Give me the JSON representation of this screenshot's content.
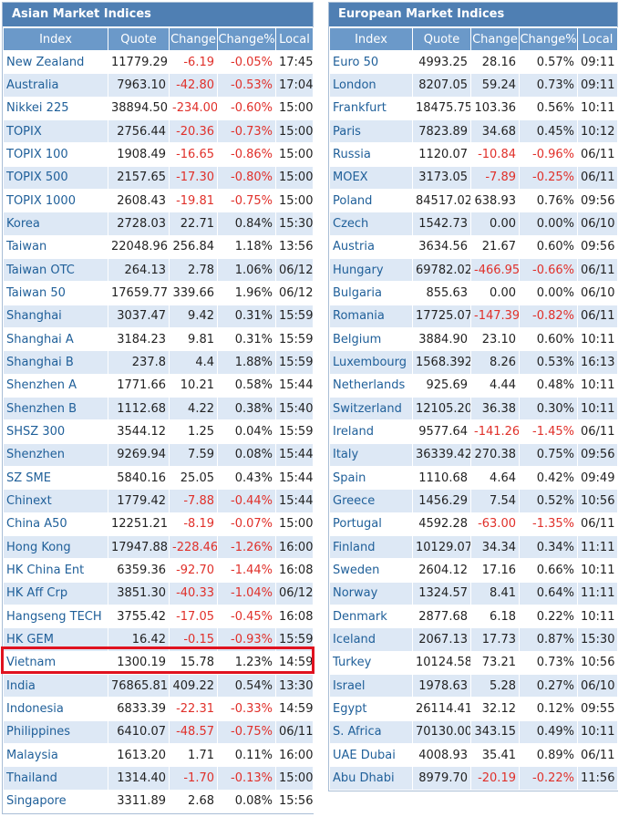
{
  "asia": {
    "title": "Asian Market Indices",
    "columns": [
      "Index",
      "Quote",
      "Change",
      "Change%",
      "Local"
    ],
    "rows": [
      {
        "name": "New Zealand",
        "quote": "11779.29",
        "change": "-6.19",
        "pct": "-0.05%",
        "time": "17:45"
      },
      {
        "name": "Australia",
        "quote": "7963.10",
        "change": "-42.80",
        "pct": "-0.53%",
        "time": "17:04"
      },
      {
        "name": "Nikkei 225",
        "quote": "38894.50",
        "change": "-234.00",
        "pct": "-0.60%",
        "time": "15:00"
      },
      {
        "name": "TOPIX",
        "quote": "2756.44",
        "change": "-20.36",
        "pct": "-0.73%",
        "time": "15:00"
      },
      {
        "name": "TOPIX 100",
        "quote": "1908.49",
        "change": "-16.65",
        "pct": "-0.86%",
        "time": "15:00"
      },
      {
        "name": "TOPIX 500",
        "quote": "2157.65",
        "change": "-17.30",
        "pct": "-0.80%",
        "time": "15:00"
      },
      {
        "name": "TOPIX 1000",
        "quote": "2608.43",
        "change": "-19.81",
        "pct": "-0.75%",
        "time": "15:00"
      },
      {
        "name": "Korea",
        "quote": "2728.03",
        "change": "22.71",
        "pct": "0.84%",
        "time": "15:30"
      },
      {
        "name": "Taiwan",
        "quote": "22048.96",
        "change": "256.84",
        "pct": "1.18%",
        "time": "13:56"
      },
      {
        "name": "Taiwan OTC",
        "quote": "264.13",
        "change": "2.78",
        "pct": "1.06%",
        "time": "06/12"
      },
      {
        "name": "Taiwan 50",
        "quote": "17659.77",
        "change": "339.66",
        "pct": "1.96%",
        "time": "06/12"
      },
      {
        "name": "Shanghai",
        "quote": "3037.47",
        "change": "9.42",
        "pct": "0.31%",
        "time": "15:59"
      },
      {
        "name": "Shanghai A",
        "quote": "3184.23",
        "change": "9.81",
        "pct": "0.31%",
        "time": "15:59"
      },
      {
        "name": "Shanghai B",
        "quote": "237.8",
        "change": "4.4",
        "pct": "1.88%",
        "time": "15:59"
      },
      {
        "name": "Shenzhen A",
        "quote": "1771.66",
        "change": "10.21",
        "pct": "0.58%",
        "time": "15:44"
      },
      {
        "name": "Shenzhen B",
        "quote": "1112.68",
        "change": "4.22",
        "pct": "0.38%",
        "time": "15:40"
      },
      {
        "name": "SHSZ 300",
        "quote": "3544.12",
        "change": "1.25",
        "pct": "0.04%",
        "time": "15:59"
      },
      {
        "name": "Shenzhen",
        "quote": "9269.94",
        "change": "7.59",
        "pct": "0.08%",
        "time": "15:44"
      },
      {
        "name": "SZ SME",
        "quote": "5840.16",
        "change": "25.05",
        "pct": "0.43%",
        "time": "15:44"
      },
      {
        "name": "Chinext",
        "quote": "1779.42",
        "change": "-7.88",
        "pct": "-0.44%",
        "time": "15:44"
      },
      {
        "name": "China A50",
        "quote": "12251.21",
        "change": "-8.19",
        "pct": "-0.07%",
        "time": "15:00"
      },
      {
        "name": "Hong Kong",
        "quote": "17947.88",
        "change": "-228.46",
        "pct": "-1.26%",
        "time": "16:00"
      },
      {
        "name": "HK China Ent",
        "quote": "6359.36",
        "change": "-92.70",
        "pct": "-1.44%",
        "time": "16:08"
      },
      {
        "name": "HK Aff Crp",
        "quote": "3851.30",
        "change": "-40.33",
        "pct": "-1.04%",
        "time": "06/12"
      },
      {
        "name": "Hangseng TECH",
        "quote": "3755.42",
        "change": "-17.05",
        "pct": "-0.45%",
        "time": "16:08"
      },
      {
        "name": "HK GEM",
        "quote": "16.42",
        "change": "-0.15",
        "pct": "-0.93%",
        "time": "15:59"
      },
      {
        "name": "Vietnam",
        "quote": "1300.19",
        "change": "15.78",
        "pct": "1.23%",
        "time": "14:59"
      },
      {
        "name": "India",
        "quote": "76865.81",
        "change": "409.22",
        "pct": "0.54%",
        "time": "13:30"
      },
      {
        "name": "Indonesia",
        "quote": "6833.39",
        "change": "-22.31",
        "pct": "-0.33%",
        "time": "14:59"
      },
      {
        "name": "Philippines",
        "quote": "6410.07",
        "change": "-48.57",
        "pct": "-0.75%",
        "time": "06/11"
      },
      {
        "name": "Malaysia",
        "quote": "1613.20",
        "change": "1.71",
        "pct": "0.11%",
        "time": "16:00"
      },
      {
        "name": "Thailand",
        "quote": "1314.40",
        "change": "-1.70",
        "pct": "-0.13%",
        "time": "15:00"
      },
      {
        "name": "Singapore",
        "quote": "3311.89",
        "change": "2.68",
        "pct": "0.08%",
        "time": "15:56"
      }
    ]
  },
  "europe": {
    "title": "European Market Indices",
    "columns": [
      "Index",
      "Quote",
      "Change",
      "Change%",
      "Local"
    ],
    "rows": [
      {
        "name": "Euro 50",
        "quote": "4993.25",
        "change": "28.16",
        "pct": "0.57%",
        "time": "09:11"
      },
      {
        "name": "London",
        "quote": "8207.05",
        "change": "59.24",
        "pct": "0.73%",
        "time": "09:11"
      },
      {
        "name": "Frankfurt",
        "quote": "18475.75",
        "change": "103.36",
        "pct": "0.56%",
        "time": "10:11"
      },
      {
        "name": "Paris",
        "quote": "7823.89",
        "change": "34.68",
        "pct": "0.45%",
        "time": "10:12"
      },
      {
        "name": "Russia",
        "quote": "1120.07",
        "change": "-10.84",
        "pct": "-0.96%",
        "time": "06/11"
      },
      {
        "name": "MOEX",
        "quote": "3173.05",
        "change": "-7.89",
        "pct": "-0.25%",
        "time": "06/11"
      },
      {
        "name": "Poland",
        "quote": "84517.02",
        "change": "638.93",
        "pct": "0.76%",
        "time": "09:56"
      },
      {
        "name": "Czech",
        "quote": "1542.73",
        "change": "0.00",
        "pct": "0.00%",
        "time": "06/10"
      },
      {
        "name": "Austria",
        "quote": "3634.56",
        "change": "21.67",
        "pct": "0.60%",
        "time": "09:56"
      },
      {
        "name": "Hungary",
        "quote": "69782.02",
        "change": "-466.95",
        "pct": "-0.66%",
        "time": "06/11"
      },
      {
        "name": "Bulgaria",
        "quote": "855.63",
        "change": "0.00",
        "pct": "0.00%",
        "time": "06/10"
      },
      {
        "name": "Romania",
        "quote": "17725.07",
        "change": "-147.39",
        "pct": "-0.82%",
        "time": "06/11"
      },
      {
        "name": "Belgium",
        "quote": "3884.90",
        "change": "23.10",
        "pct": "0.60%",
        "time": "10:11"
      },
      {
        "name": "Luxembourg",
        "quote": "1568.392",
        "change": "8.26",
        "pct": "0.53%",
        "time": "16:13"
      },
      {
        "name": "Netherlands",
        "quote": "925.69",
        "change": "4.44",
        "pct": "0.48%",
        "time": "10:11"
      },
      {
        "name": "Switzerland",
        "quote": "12105.20",
        "change": "36.38",
        "pct": "0.30%",
        "time": "10:11"
      },
      {
        "name": "Ireland",
        "quote": "9577.64",
        "change": "-141.26",
        "pct": "-1.45%",
        "time": "06/11"
      },
      {
        "name": "Italy",
        "quote": "36339.42",
        "change": "270.38",
        "pct": "0.75%",
        "time": "09:56"
      },
      {
        "name": "Spain",
        "quote": "1110.68",
        "change": "4.64",
        "pct": "0.42%",
        "time": "09:49"
      },
      {
        "name": "Greece",
        "quote": "1456.29",
        "change": "7.54",
        "pct": "0.52%",
        "time": "10:56"
      },
      {
        "name": "Portugal",
        "quote": "4592.28",
        "change": "-63.00",
        "pct": "-1.35%",
        "time": "06/11"
      },
      {
        "name": "Finland",
        "quote": "10129.07",
        "change": "34.34",
        "pct": "0.34%",
        "time": "11:11"
      },
      {
        "name": "Sweden",
        "quote": "2604.12",
        "change": "17.16",
        "pct": "0.66%",
        "time": "10:11"
      },
      {
        "name": "Norway",
        "quote": "1324.57",
        "change": "8.41",
        "pct": "0.64%",
        "time": "11:11"
      },
      {
        "name": "Denmark",
        "quote": "2877.68",
        "change": "6.18",
        "pct": "0.22%",
        "time": "10:11"
      },
      {
        "name": "Iceland",
        "quote": "2067.13",
        "change": "17.73",
        "pct": "0.87%",
        "time": "15:30"
      },
      {
        "name": "Turkey",
        "quote": "10124.58",
        "change": "73.21",
        "pct": "0.73%",
        "time": "10:56"
      },
      {
        "name": "Israel",
        "quote": "1978.63",
        "change": "5.28",
        "pct": "0.27%",
        "time": "06/10"
      },
      {
        "name": "Egypt",
        "quote": "26114.41",
        "change": "32.12",
        "pct": "0.12%",
        "time": "09:55"
      },
      {
        "name": "S. Africa",
        "quote": "70130.00",
        "change": "343.15",
        "pct": "0.49%",
        "time": "10:11"
      },
      {
        "name": "UAE Dubai",
        "quote": "4008.93",
        "change": "35.41",
        "pct": "0.89%",
        "time": "06/11"
      },
      {
        "name": "Abu Dhabi",
        "quote": "8979.70",
        "change": "-20.19",
        "pct": "-0.22%",
        "time": "11:56"
      }
    ]
  },
  "highlighted_row": "Vietnam",
  "colors": {
    "header_bg": "#4f7fb3",
    "column_header_bg": "#6b99c9",
    "row_alt_bg": "#dde8f5",
    "link_text": "#1f5f99",
    "negative": "#e0302a",
    "positive": "#3a7d2c",
    "highlight_border": "#e0121f"
  }
}
